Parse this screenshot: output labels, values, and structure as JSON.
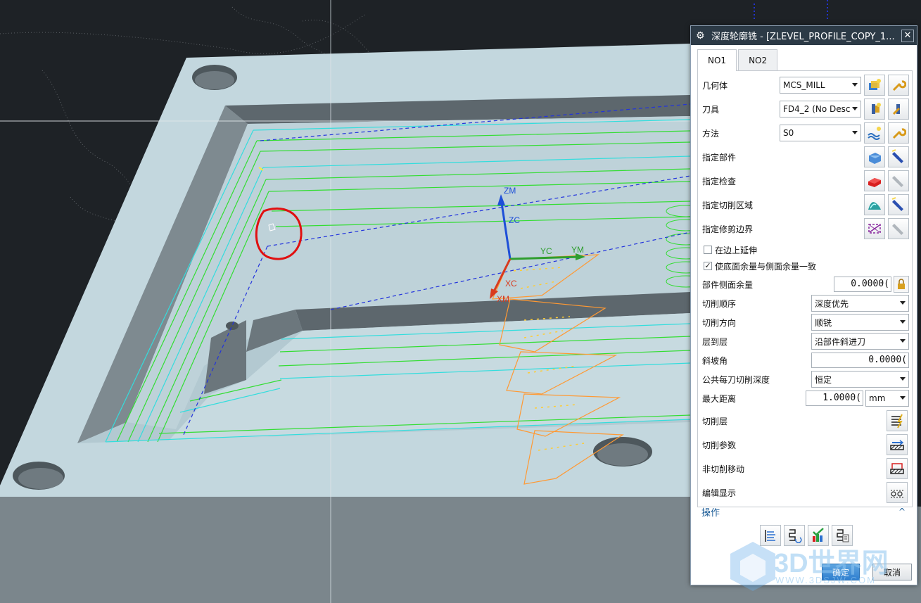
{
  "viewport": {
    "axes": {
      "zm": "ZM",
      "zc": "ZC",
      "yc": "YC",
      "ym": "YM",
      "xc": "XC",
      "xm": "XM"
    }
  },
  "dialog": {
    "title": "深度轮廓铣 - [ZLEVEL_PROFILE_COPY_1...",
    "close_glyph": "✕",
    "tabs": [
      {
        "label": "NO1",
        "active": true
      },
      {
        "label": "NO2",
        "active": false
      }
    ],
    "geometry": {
      "label": "几何体",
      "value": "MCS_MILL"
    },
    "tool": {
      "label": "刀具",
      "value": "FD4_2 (No Desc"
    },
    "method": {
      "label": "方法",
      "value": "S0"
    },
    "specify_part": {
      "label": "指定部件"
    },
    "specify_check": {
      "label": "指定检查"
    },
    "specify_cut_area": {
      "label": "指定切削区域"
    },
    "specify_trim": {
      "label": "指定修剪边界"
    },
    "extend_edge": {
      "label": "在边上延伸",
      "checked": false
    },
    "floor_same_as_wall": {
      "label": "使底面余量与侧面余量一致",
      "checked": true,
      "check_glyph": "✓"
    },
    "part_wall_stock": {
      "label": "部件侧面余量",
      "value": "0.0000("
    },
    "cut_order": {
      "label": "切削顺序",
      "value": "深度优先"
    },
    "cut_direction": {
      "label": "切削方向",
      "value": "顺铣"
    },
    "level_to_level": {
      "label": "层到层",
      "value": "沿部件斜进刀"
    },
    "ramp_angle": {
      "label": "斜坡角",
      "value": "0.0000("
    },
    "common_depth": {
      "label": "公共每刀切削深度",
      "value": "恒定"
    },
    "max_distance": {
      "label": "最大距离",
      "value": "1.0000(",
      "unit": "mm"
    },
    "cut_levels": {
      "label": "切削层"
    },
    "cutting_params": {
      "label": "切削参数"
    },
    "non_cutting_moves": {
      "label": "非切削移动"
    },
    "edit_display": {
      "label": "编辑显示"
    },
    "actions_section": {
      "label": "操作",
      "caret": "^"
    },
    "ok_label": "确定",
    "cancel_label": "取消"
  },
  "watermark": {
    "text": "3D世界网",
    "subtext": "WWW.3DSJW.COM"
  },
  "colors": {
    "background": "#1e2226",
    "part_face": "#c2d6dd",
    "part_side": "#7f8a90",
    "toolpath_green": "#33dd33",
    "toolpath_cyan": "#33dddd",
    "orange_path": "#ff9933",
    "highlight_red": "#e01010",
    "title_bar": "#2c3a46"
  }
}
